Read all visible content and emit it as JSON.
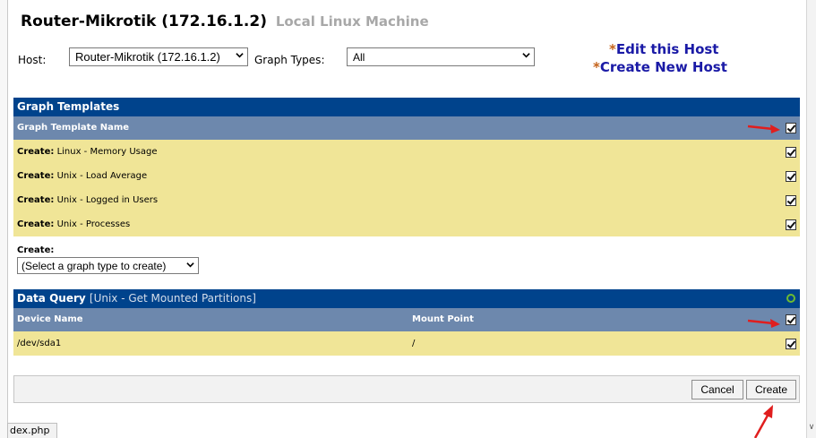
{
  "header": {
    "title": "Router-Mikrotik (172.16.1.2)",
    "subtitle": "Local Linux Machine"
  },
  "controls": {
    "host_label": "Host:",
    "host_value": "Router-Mikrotik (172.16.1.2)",
    "graph_types_label": "Graph Types:",
    "graph_types_value": "All"
  },
  "links": {
    "edit_host": "Edit this Host",
    "create_host": "Create New Host",
    "marker": "*"
  },
  "graph_templates": {
    "title": "Graph Templates",
    "column": "Graph Template Name",
    "row_prefix": "Create:",
    "rows": [
      {
        "name": "Linux - Memory Usage",
        "checked": true
      },
      {
        "name": "Unix - Load Average",
        "checked": true
      },
      {
        "name": "Unix - Logged in Users",
        "checked": true
      },
      {
        "name": "Unix - Processes",
        "checked": true
      }
    ]
  },
  "create_section": {
    "label": "Create:",
    "select_value": "(Select a graph type to create)"
  },
  "data_query": {
    "title": "Data Query",
    "subtitle": "[Unix - Get Mounted Partitions]",
    "columns": [
      "Device Name",
      "Mount Point"
    ],
    "rows": [
      {
        "device": "/dev/sda1",
        "mount": "/",
        "checked": true
      }
    ]
  },
  "buttons": {
    "cancel": "Cancel",
    "create": "Create"
  },
  "status": {
    "url_fragment": "dex.php"
  },
  "colors": {
    "panel_header": "#00438c",
    "column_header": "#6d88ad",
    "row_highlight": "#f0e597",
    "link": "#1a1aa6",
    "link_marker": "#c4621a",
    "annotation_arrow": "#e01e1e"
  }
}
